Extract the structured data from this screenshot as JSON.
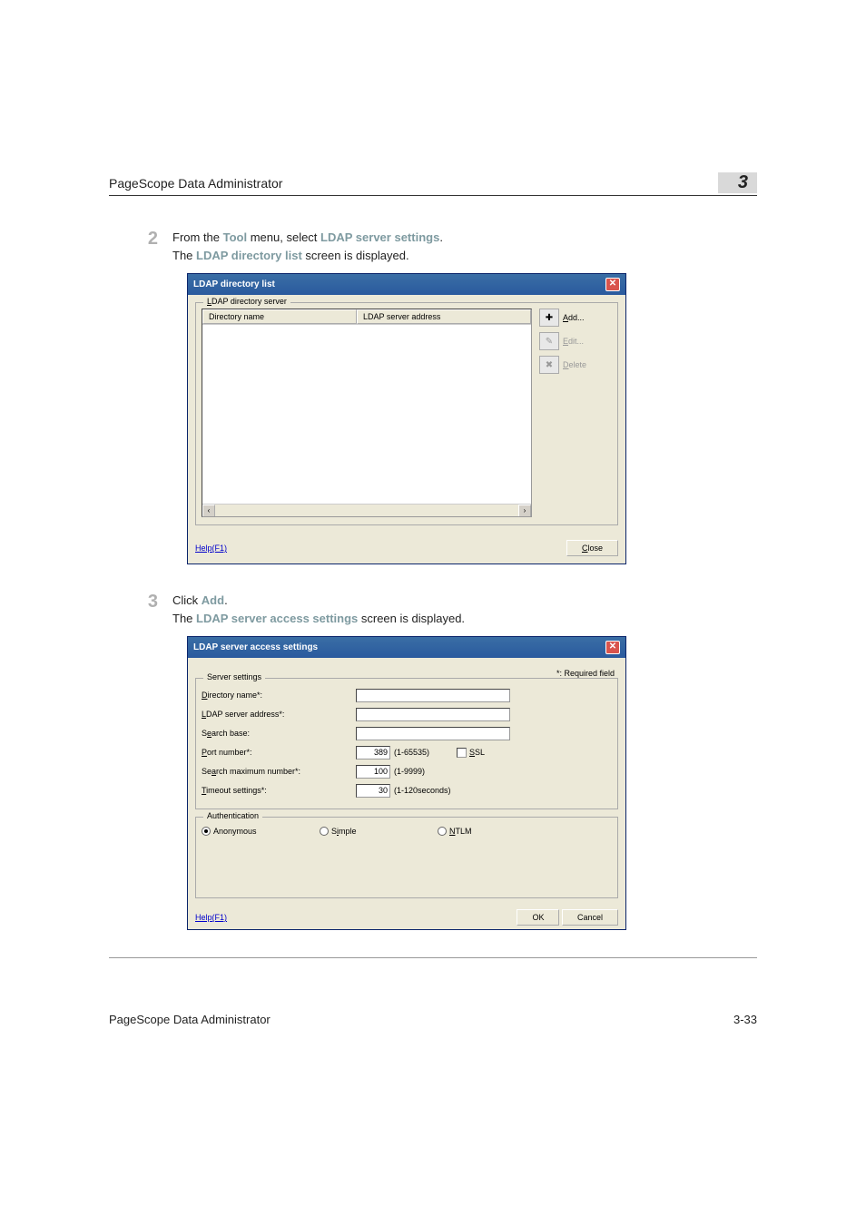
{
  "header": {
    "title": "PageScope Data Administrator",
    "chapter": "3"
  },
  "step2": {
    "number": "2",
    "prefix": "From the ",
    "kw1": "Tool",
    "mid1": " menu, select ",
    "kw2": "LDAP server settings",
    "suffix1": ".",
    "line2a": "The ",
    "kw3": "LDAP directory list",
    "line2b": " screen is displayed."
  },
  "dlg1": {
    "title": "LDAP directory list",
    "group_legend": "LDAP directory server",
    "col1": "Directory name",
    "col2": "LDAP server address",
    "add": "Add...",
    "edit": "Edit...",
    "delete": "Delete",
    "help": "Help(F1)",
    "close": "Close",
    "scroll_left": "‹",
    "scroll_right": "›"
  },
  "step3": {
    "number": "3",
    "prefix": "Click ",
    "kw1": "Add",
    "suffix": ".",
    "line2a": "The ",
    "kw2": "LDAP server access settings",
    "line2b": " screen is displayed."
  },
  "dlg2": {
    "title": "LDAP server access settings",
    "required": "*: Required field",
    "group1": "Server settings",
    "dir_name": "Directory name*:",
    "ldap_addr": "LDAP server address*:",
    "search_base": "Search base:",
    "port": "Port number*:",
    "port_value": "389",
    "port_range": "(1-65535)",
    "ssl": "SSL",
    "max_label": "Search maximum number*:",
    "max_value": "100",
    "max_range": "(1-9999)",
    "timeout_label": "Timeout settings*:",
    "timeout_value": "30",
    "timeout_range": "(1-120seconds)",
    "group2": "Authentication",
    "anonymous": "Anonymous",
    "simple": "Simple",
    "ntlm": "NTLM",
    "help": "Help(F1)",
    "ok": "OK",
    "cancel": "Cancel"
  },
  "footer": {
    "left": "PageScope Data Administrator",
    "right": "3-33"
  }
}
